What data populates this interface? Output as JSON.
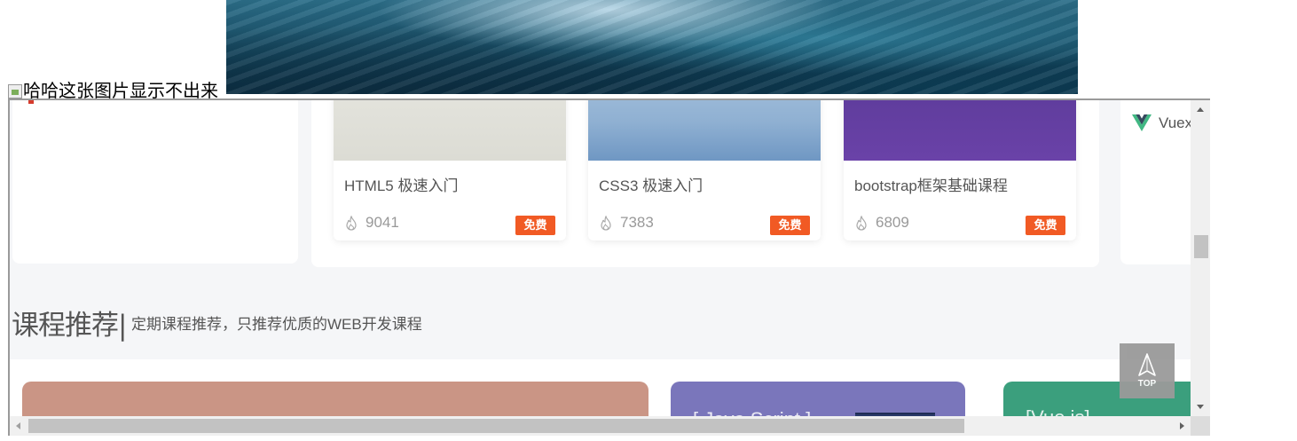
{
  "page": {
    "broken_image_alt": "哈哈这张图片显示不出来"
  },
  "courses": [
    {
      "title": "HTML5 极速入门",
      "views": "9041",
      "tag": "免费"
    },
    {
      "title": "CSS3 极速入门",
      "views": "7383",
      "tag": "免费"
    },
    {
      "title": "bootstrap框架基础课程",
      "views": "6809",
      "tag": "免费"
    }
  ],
  "side_link": {
    "label": "Vuex"
  },
  "recommend": {
    "title": "课程推荐|",
    "subtitle": "定期课程推荐，只推荐优质的WEB开发课程"
  },
  "banners": [
    {
      "text": ""
    },
    {
      "text": "[ Java Script ]"
    },
    {
      "text": "[Vue.js]"
    }
  ],
  "back_to_top": {
    "label": "TOP"
  },
  "colors": {
    "accent": "#f15a24",
    "page_bg": "#f5f6f8",
    "vue_green": "#41b883",
    "vue_dark": "#35495e"
  }
}
